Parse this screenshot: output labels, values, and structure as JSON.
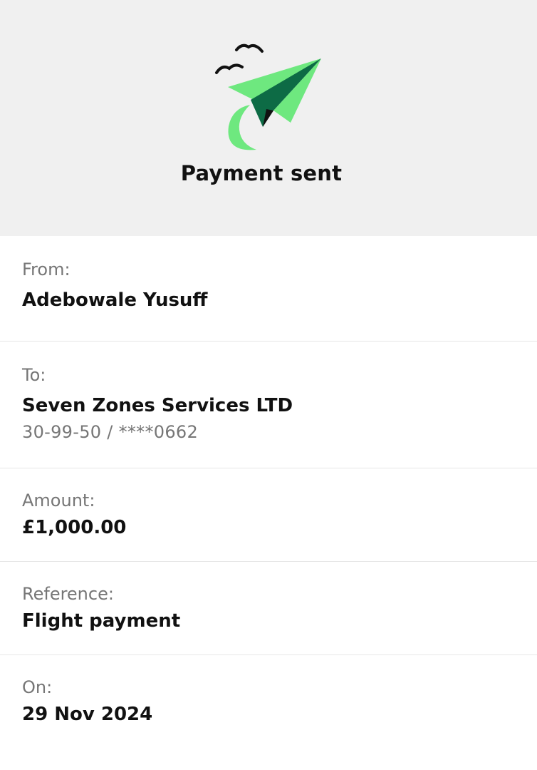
{
  "header": {
    "title": "Payment sent",
    "illustration_icon": "paper-plane-icon"
  },
  "details": {
    "from": {
      "label": "From:",
      "value": "Adebowale Yusuff"
    },
    "to": {
      "label": "To:",
      "value": "Seven Zones Services LTD",
      "account": "30-99-50 / ****0662"
    },
    "amount": {
      "label": "Amount:",
      "value": "£1,000.00"
    },
    "reference": {
      "label": "Reference:",
      "value": "Flight payment"
    },
    "on": {
      "label": "On:",
      "value": "29 Nov 2024"
    }
  },
  "colors": {
    "hero_background": "#f0f0f0",
    "plane_light_green": "#6ee87f",
    "plane_dark_green": "#0d6b45",
    "label_grey": "#767676",
    "text_dark": "#111111"
  }
}
